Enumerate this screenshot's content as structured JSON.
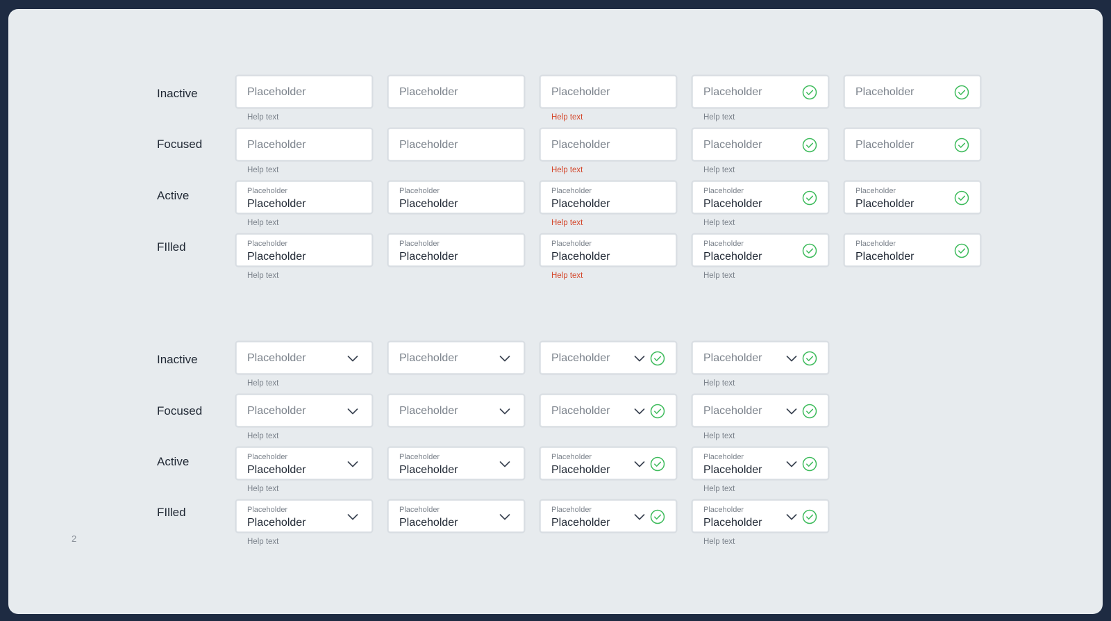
{
  "page_number": "2",
  "colors": {
    "frame_bg": "#1e2b42",
    "canvas_bg": "#e7ebee",
    "error": "#d4472b",
    "success": "#3dbb5b",
    "text_primary": "#1f2733",
    "text_muted": "#7b828b"
  },
  "text_inputs": {
    "row_labels": [
      "Inactive",
      "Focused",
      "Active",
      "FIlled"
    ],
    "placeholder": "Placeholder",
    "floating_label": "Placeholder",
    "value": "Placeholder",
    "help_text": "Help text",
    "columns": [
      {
        "help": "normal",
        "icon": "none"
      },
      {
        "help": "none",
        "icon": "none"
      },
      {
        "help": "error",
        "icon": "none"
      },
      {
        "help": "normal",
        "icon": "check-circle-icon"
      },
      {
        "help": "none",
        "icon": "check-circle-icon"
      }
    ]
  },
  "dropdowns": {
    "row_labels": [
      "Inactive",
      "Focused",
      "Active",
      "FIlled"
    ],
    "placeholder": "Placeholder",
    "floating_label": "Placeholder",
    "value": "Placeholder",
    "help_text": "Help text",
    "columns": [
      {
        "help": "normal",
        "icon": "chevron-down-icon"
      },
      {
        "help": "none",
        "icon": "chevron-down-icon"
      },
      {
        "help": "none",
        "icon": "chevron-down-icon+check-circle-icon"
      },
      {
        "help": "normal",
        "icon": "chevron-down-icon+check-circle-icon"
      }
    ]
  }
}
